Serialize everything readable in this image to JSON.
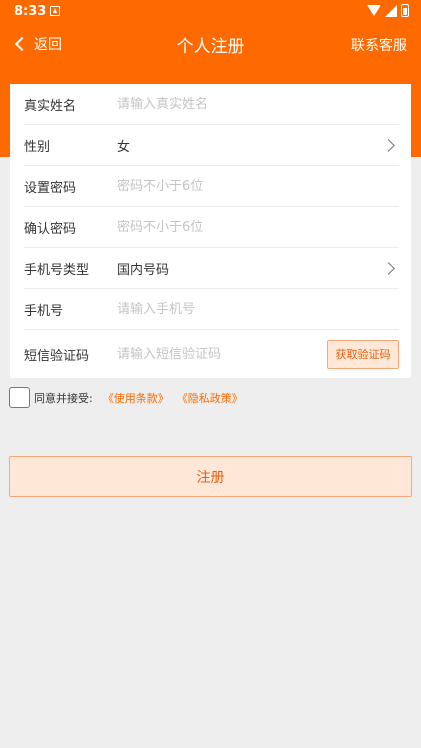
{
  "status_bar": {
    "time": "8:33"
  },
  "nav": {
    "back_label": "返回",
    "title": "个人注册",
    "contact_label": "联系客服"
  },
  "form": {
    "rows": [
      {
        "label": "真实姓名",
        "placeholder": "请输入真实姓名"
      },
      {
        "label": "性别",
        "value": "女"
      },
      {
        "label": "设置密码",
        "placeholder": "密码不小于6位"
      },
      {
        "label": "确认密码",
        "placeholder": "密码不小于6位"
      },
      {
        "label": "手机号类型",
        "value": "国内号码"
      },
      {
        "label": "手机号",
        "placeholder": "请输入手机号"
      },
      {
        "label": "短信验证码",
        "placeholder": "请输入短信验证码"
      }
    ],
    "get_code_label": "获取验证码"
  },
  "agreement": {
    "text": "同意并接受:",
    "terms_link": "《使用条款》",
    "privacy_link": "《隐私政策》",
    "checked": false
  },
  "submit_label": "注册",
  "colors": {
    "primary": "#ff6a00",
    "button_bg": "#ffe8d8",
    "button_border": "#f5a679",
    "page_bg": "#eeeeee"
  }
}
